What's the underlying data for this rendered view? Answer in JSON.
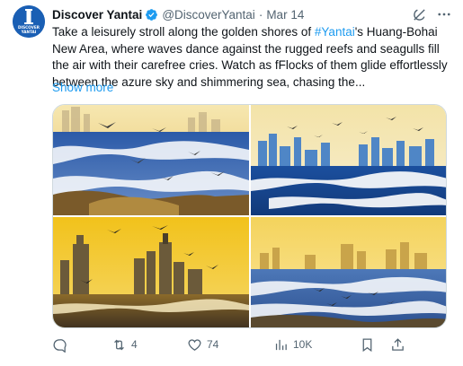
{
  "tweet": {
    "author": {
      "display_name": "Discover Yantai",
      "handle": "@DiscoverYantai",
      "avatar_text": "DISCOVER\nYANTAI",
      "verified": true
    },
    "date": "Mar 14",
    "separator": "·",
    "text_parts": {
      "pre": "Take a leisurely stroll along the golden shores of ",
      "hashtag": "#Yantai",
      "post": "'s Huang-Bohai New Area, where waves dance against the rugged reefs and seagulls fill the air with their carefree cries. Watch as fFlocks of them glide effortlessly between the azure sky and shimmering sea, chasing the..."
    },
    "show_more": "Show more",
    "icons": {
      "grok": "grok-icon",
      "more": "more-icon",
      "reply": "reply-icon",
      "retweet": "retweet-icon",
      "like": "heart-icon",
      "views": "views-icon",
      "bookmark": "bookmark-icon",
      "share": "share-icon"
    },
    "stats": {
      "replies": "",
      "retweets": "4",
      "likes": "74",
      "views": "10K"
    },
    "media_count": 4
  },
  "colors": {
    "accent": "#1d9bf0",
    "text": "#0f1419",
    "muted": "#536471",
    "border": "#cfd9de"
  }
}
